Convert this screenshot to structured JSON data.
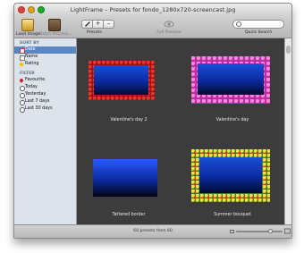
{
  "window": {
    "title": "LightFrame – Presets for fondo_1280x720-screencast.jpg"
  },
  "toolbar": {
    "load_image": "Load Image",
    "batch_process": "Batch Process...",
    "presets": "Presets",
    "full_preview": "Full Preview",
    "quick_search": "Quick Search",
    "search_placeholder": "",
    "segments": [
      "+",
      "–"
    ]
  },
  "sidebar": {
    "sort_header": "SORT BY",
    "sort_items": [
      {
        "label": "Date",
        "selected": true
      },
      {
        "label": "Name",
        "selected": false
      },
      {
        "label": "Rating",
        "selected": false
      }
    ],
    "filter_header": "FILTER",
    "filter_items": [
      {
        "label": "Favourite"
      },
      {
        "label": "Today"
      },
      {
        "label": "Yesterday"
      },
      {
        "label": "Last 7 days"
      },
      {
        "label": "Last 30 days"
      }
    ]
  },
  "presets": [
    {
      "name": "Valentine's day 2",
      "border_color": "#b8141a"
    },
    {
      "name": "Valentine's day",
      "border_color": "#d23ab4"
    },
    {
      "name": "Tattered border",
      "border_color": "#2a2a2a"
    },
    {
      "name": "Summer bouquet",
      "border_color": "#d9a020"
    }
  ],
  "status": {
    "text": "60 presets from 60"
  },
  "colors": {
    "selection": "#5c86c2",
    "content_bg": "#3c3c3c"
  }
}
